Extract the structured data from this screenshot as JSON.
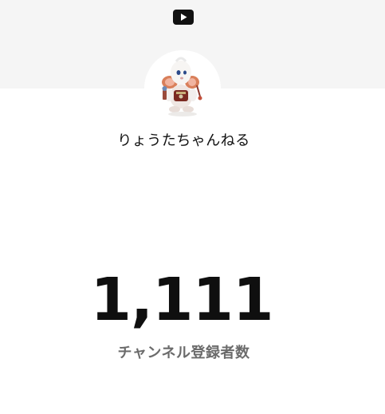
{
  "header": {
    "logo_icon": "youtube-icon"
  },
  "channel": {
    "avatar_icon": "mouse-character-avatar",
    "name": "りょうたちゃんねる"
  },
  "stats": {
    "subscriber_count": "1,111",
    "subscriber_label": "チャンネル登録者数"
  },
  "colors": {
    "banner_bg": "#f5f5f5",
    "page_bg": "#ffffff",
    "count_text": "#0f0f0f",
    "label_text": "#6b6b6b"
  }
}
